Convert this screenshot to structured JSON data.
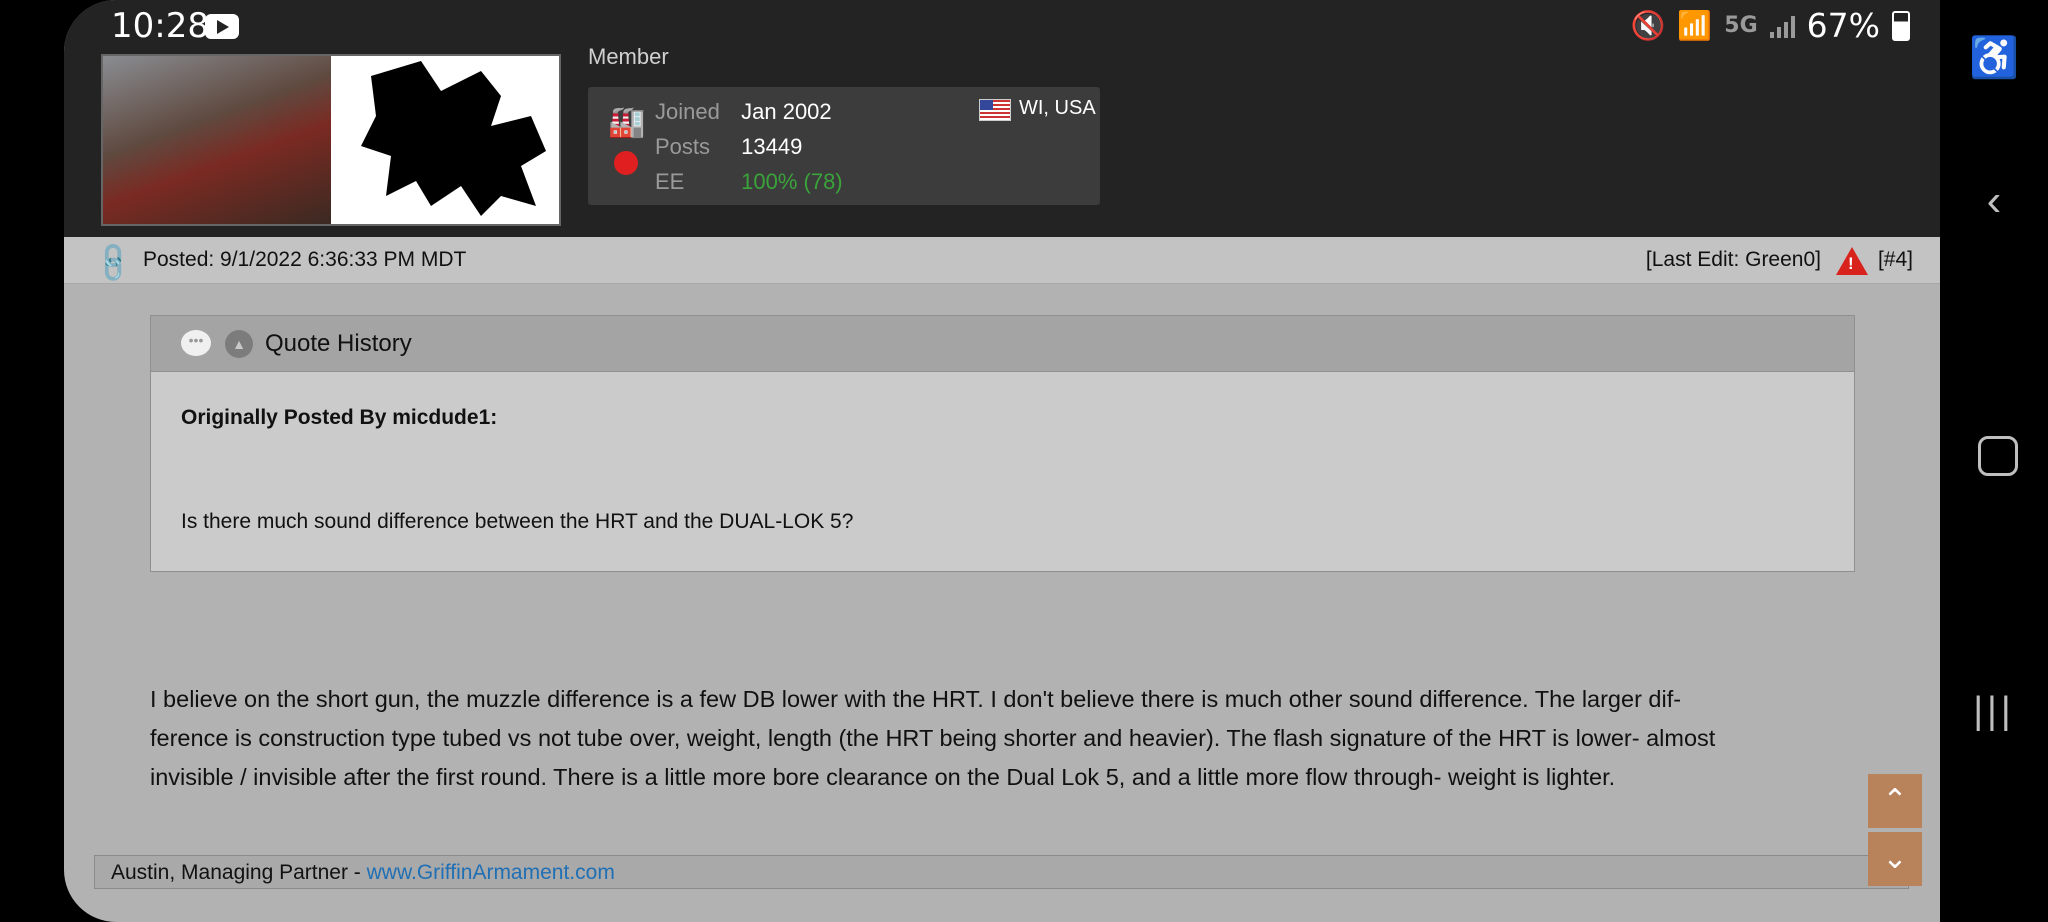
{
  "status_bar": {
    "time": "10:28",
    "network": "5G",
    "battery": "67%",
    "icons": [
      "youtube-icon",
      "mute-icon",
      "wifi-icon",
      "signal-icon",
      "battery-icon"
    ]
  },
  "profile": {
    "rank": "Member",
    "joined_label": "Joined",
    "joined_value": "Jan 2002",
    "posts_label": "Posts",
    "posts_value": "13449",
    "ee_label": "EE",
    "ee_value": "100% (78)",
    "location": "WI, USA"
  },
  "post": {
    "posted": "Posted: 9/1/2022 6:36:33 PM MDT",
    "last_edit": "[Last Edit: Green0]",
    "post_number": "[#4]",
    "quote_title": "Quote History",
    "quote_by": "Originally Posted By micdude1:",
    "quote_text": "Is there much sound difference between the HRT and the  DUAL-LOK 5?",
    "body_line1": "I believe on the short gun, the muzzle difference is a few DB lower with the HRT.  I don't believe there is much other sound difference.  The larger dif-",
    "body_line2": "ference is construction type tubed vs not tube over, weight, length (the HRT being shorter and heavier). The flash signature of the HRT is lower- almost",
    "body_line3": "invisible / invisible after the first round.  There is a little more bore clearance on the Dual Lok 5, and a little more flow through- weight is lighter.",
    "signature_text": "Austin, Managing Partner - ",
    "signature_link": "www.GriffinArmament.com"
  },
  "colors": {
    "accent_link": "#1f6fb5",
    "ee_green": "#3aa33a",
    "status_red": "#e02020",
    "scroll_button": "#b8835a"
  }
}
